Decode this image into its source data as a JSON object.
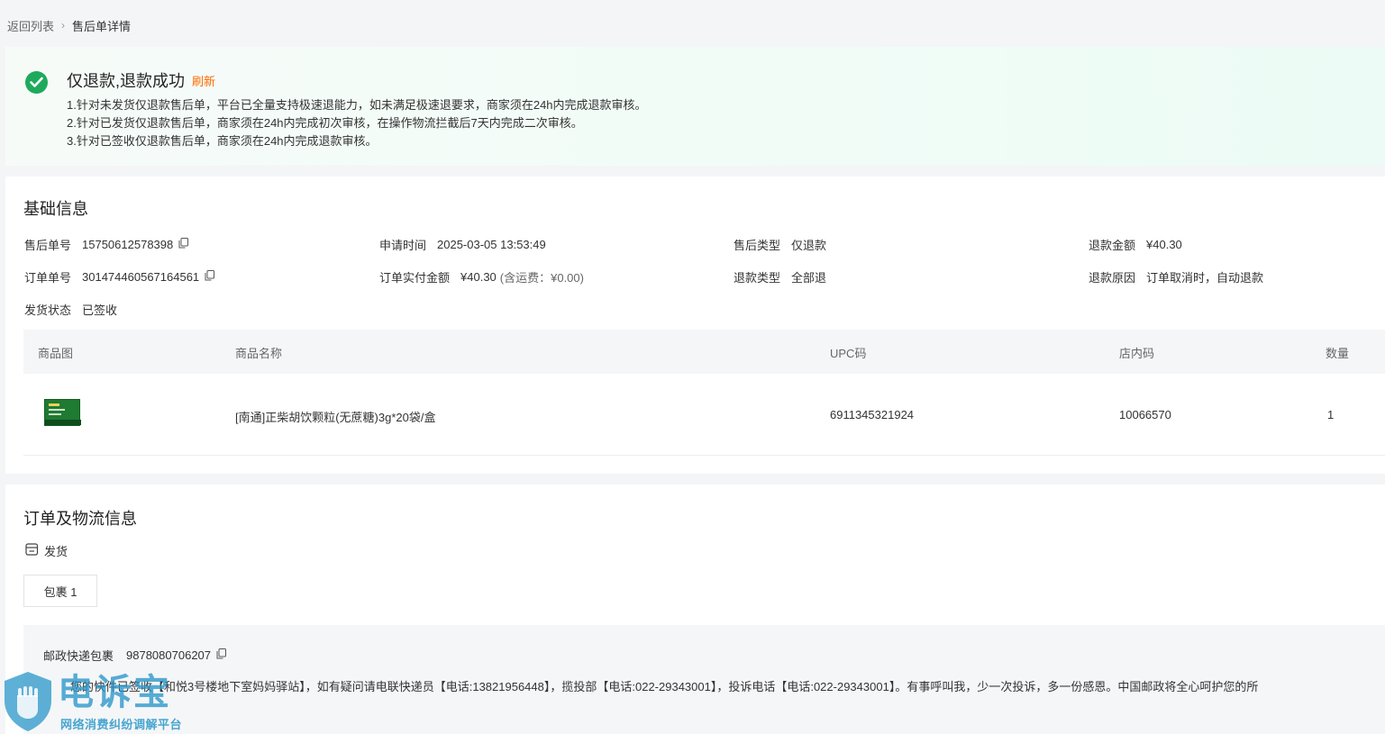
{
  "breadcrumb": {
    "back": "返回列表",
    "separator": "›",
    "current": "售后单详情"
  },
  "status": {
    "title": "仅退款,退款成功",
    "refresh": "刷新",
    "rules": [
      "1.针对未发货仅退款售后单，平台已全量支持极速退能力，如未满足极速退要求，商家须在24h内完成退款审核。",
      "2.针对已发货仅退款售后单，商家须在24h内完成初次审核，在操作物流拦截后7天内完成二次审核。",
      "3.针对已签收仅退款售后单，商家须在24h内完成退款审核。"
    ]
  },
  "basic": {
    "title": "基础信息",
    "after_sale_no": {
      "label": "售后单号",
      "value": "15750612578398"
    },
    "apply_time": {
      "label": "申请时间",
      "value": "2025-03-05 13:53:49"
    },
    "after_sale_type": {
      "label": "售后类型",
      "value": "仅退款"
    },
    "refund_amount": {
      "label": "退款金额",
      "value": "¥40.30"
    },
    "order_no": {
      "label": "订单单号",
      "value": "301474460567164561"
    },
    "paid_amount": {
      "label": "订单实付金额",
      "value": "¥40.30",
      "note": "(含运费：¥0.00)"
    },
    "refund_type": {
      "label": "退款类型",
      "value": "全部退"
    },
    "refund_reason": {
      "label": "退款原因",
      "value": "订单取消时，自动退款"
    },
    "ship_status": {
      "label": "发货状态",
      "value": "已签收"
    }
  },
  "goods": {
    "headers": {
      "image": "商品图",
      "name": "商品名称",
      "upc": "UPC码",
      "store_code": "店内码",
      "qty": "数量"
    },
    "rows": [
      {
        "name": "[南通]正柴胡饮颗粒(无蔗糖)3g*20袋/盒",
        "upc": "6911345321924",
        "store_code": "10066570",
        "qty": "1"
      }
    ]
  },
  "logistics": {
    "title": "订单及物流信息",
    "ship_label": "发货",
    "package_tab": "包裹 1",
    "carrier": "邮政快递包裹",
    "tracking_no": "9878080706207",
    "tracking_text": "您的快件已签收【和悦3号楼地下室妈妈驿站】，如有疑问请电联快递员【电话:13821956448】，揽投部【电话:022-29343001】，投诉电话【电话:022-29343001】。有事呼叫我，少一次投诉，多一份感恩。中国邮政将全心呵护您的所"
  },
  "watermark": {
    "title": "电诉宝",
    "subtitle": "网络消费纠纷调解平台"
  },
  "colors": {
    "success": "#1eaa5c",
    "refresh": "#ff6a00",
    "watermark": "#2896c8"
  }
}
